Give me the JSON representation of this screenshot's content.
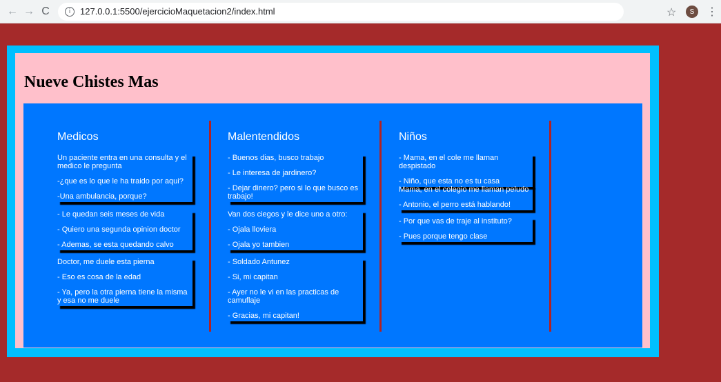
{
  "browser": {
    "url": "127.0.0.1:5500/ejercicioMaquetacion2/index.html",
    "avatar_letter": "S"
  },
  "page": {
    "title": "Nueve Chistes Mas"
  },
  "columns": [
    {
      "heading": "Medicos",
      "groups": [
        [
          "Un paciente entra en una consulta y el medico le pregunta",
          "-¿que es lo que le ha traido por aqui?",
          "-Una ambulancia, porque?"
        ],
        [
          "- Le quedan seis meses de vida",
          "- Quiero una segunda opinion doctor",
          "- Ademas, se esta quedando calvo"
        ],
        [
          "Doctor, me duele esta pierna",
          "- Eso es cosa de la edad",
          "- Ya, pero la otra pierna tiene la misma y esa no me duele"
        ]
      ]
    },
    {
      "heading": "Malentendidos",
      "groups": [
        [
          "- Buenos dias, busco trabajo",
          "- Le interesa de jardinero?",
          "- Dejar dinero? pero si lo que busco es trabajo!"
        ],
        [
          "Van dos ciegos y le dice uno a otro:",
          "- Ojala lloviera",
          "- Ojala yo tambien"
        ],
        [
          "- Soldado Antunez",
          "- Si, mi capitan",
          "- Ayer no le vi en las practicas de camuflaje",
          "- Gracias, mi capitan!"
        ]
      ]
    },
    {
      "heading": "Niños",
      "groups": [
        [
          "- Mama, en el cole me llaman despistado",
          "- Niño, que esta no es tu casa"
        ],
        [
          "Mama, en el colegio me llaman peludo",
          "- Antonio, el perro está hablando!"
        ],
        [
          "- Por que vas de traje al instituto?",
          "- Pues porque tengo clase"
        ]
      ]
    }
  ]
}
